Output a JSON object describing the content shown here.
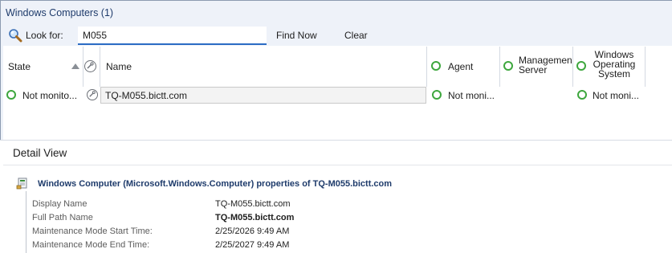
{
  "panel": {
    "title": "Windows Computers (1)"
  },
  "search": {
    "label": "Look for:",
    "value": "M055",
    "find_now_label": "Find Now",
    "clear_label": "Clear"
  },
  "grid": {
    "columns": {
      "state": "State",
      "name": "Name",
      "agent": "Agent",
      "management_server": [
        "Managemen",
        "Server"
      ],
      "windows_os": [
        "Windows",
        "Operating",
        "System"
      ]
    },
    "sort": {
      "column": "State",
      "direction": "ascending"
    },
    "rows": [
      {
        "state": "Not monito...",
        "name": "TQ-M055.bictt.com",
        "agent": "Not moni...",
        "windows_os": "Not moni..."
      }
    ]
  },
  "detail": {
    "title": "Detail View",
    "header": "Windows Computer (Microsoft.Windows.Computer) properties of TQ-M055.bictt.com",
    "properties": [
      {
        "label": "Display Name",
        "value": "TQ-M055.bictt.com",
        "bold": false
      },
      {
        "label": "Full Path Name",
        "value": "TQ-M055.bictt.com",
        "bold": true
      },
      {
        "label": "Maintenance Mode Start Time:",
        "value": "2/25/2026 9:49 AM",
        "bold": false
      },
      {
        "label": "Maintenance Mode End Time:",
        "value": "2/25/2027 9:49 AM",
        "bold": false
      }
    ]
  },
  "colors": {
    "pane_background": "#eef2f9",
    "title_text": "#1e3b6b",
    "healthy_green": "#3ea73e",
    "input_underline": "#2b6cc4"
  },
  "icons": {
    "search": "magnifier-icon",
    "maintenance": "wrench-icon",
    "state": "green-ring-icon",
    "properties": "computer-properties-icon"
  }
}
